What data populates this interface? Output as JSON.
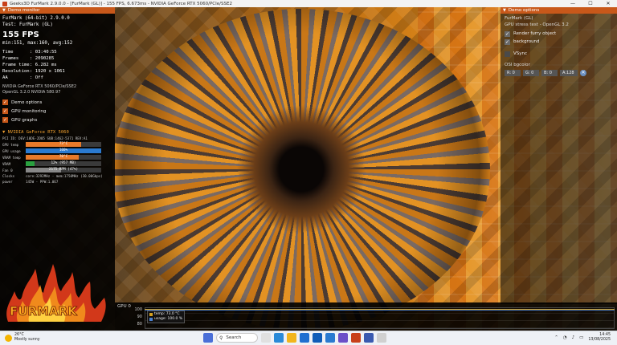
{
  "window": {
    "title": "Geeks3D FurMark 2.9.0.0 - [FurMark (GL)] - 155 FPS, 6.673ms - NVIDIA GeForce RTX 5060/PCIe/SSE2",
    "minimize": "—",
    "maximize": "☐",
    "close": "✕"
  },
  "demo_monitor": {
    "header": "Demo monitor",
    "app_line": "FurMark (64-bit) 2.9.0.0",
    "test_line": "Test: FurMark (GL)",
    "fps": "155 FPS",
    "fps_stats": "min:151, max:160, avg:152",
    "stats": [
      {
        "key": "Time",
        "value": ": 03:40:55"
      },
      {
        "key": "Frames",
        "value": ": 2090285"
      },
      {
        "key": "Frame time",
        "value": ": 6.282 ms"
      },
      {
        "key": "Resolution",
        "value": ": 1920 x 1061"
      },
      {
        "key": "AA",
        "value": ": Off"
      }
    ],
    "gpu_info": [
      "NVIDIA GeForce RTX 5060/PCIe/SSE2",
      "OpenGL 3.2.0 NVIDIA 580.97"
    ],
    "checkboxes": [
      {
        "label": "Demo options",
        "checked": true
      },
      {
        "label": "GPU monitoring",
        "checked": true
      },
      {
        "label": "GPU graphs",
        "checked": true
      }
    ],
    "gpu_monitor": {
      "header": "NVIDIA GeForce RTX 5060",
      "pci_line": "PCI ID:   DEV:10DE-2D05 SUB:1462-5371 REV:A1",
      "bars": [
        {
          "label": "GPU temp",
          "text": "73°C",
          "fraction": 0.73,
          "color": "#e87a2a"
        },
        {
          "label": "GPU usage",
          "text": "100%",
          "fraction": 1.0,
          "color": "#2a7ad0"
        },
        {
          "label": "VRAM temp",
          "text": "70°C",
          "fraction": 0.7,
          "color": "#e87a2a"
        },
        {
          "label": "VRAM",
          "text": "12% (957 MB)",
          "fraction": 0.12,
          "color": "#2aa040"
        },
        {
          "label": "Fan 0",
          "text": "2175 RPM (47%)",
          "fraction": 0.47,
          "color": "#888888"
        }
      ],
      "clocks_label": "Clocks",
      "clocks_value": "core:3292MHz - mem:1750MHz (30.00Gbps)",
      "power_label": "power",
      "power_value": "145W - PPW:1.067"
    },
    "logo_text": "FURMARK"
  },
  "demo_options": {
    "header": "Demo options",
    "line1": "FurMark (GL)",
    "line2": "GPU stress test - OpenGL 3.2",
    "checkboxes": [
      {
        "label": "Render furry object",
        "checked": true
      },
      {
        "label": "background",
        "checked": true
      },
      {
        "label": "VSync",
        "checked": false
      }
    ],
    "osi_label": "OSI bgcolor",
    "osi_fields": [
      "R: 0",
      "G: 0",
      "B: 0",
      "A:128"
    ],
    "reset": "✕"
  },
  "gpu_graph": {
    "label": "GPU 0",
    "ticks": [
      "100",
      "90",
      "80"
    ],
    "legend": [
      {
        "text": "temp: 73.0 °C",
        "color": "#d4a020"
      },
      {
        "text": "usage: 100.0 %",
        "color": "#4a80d0"
      }
    ]
  },
  "taskbar": {
    "weather_temp": "26°C",
    "weather_desc": "Mostly sunny",
    "search_placeholder": "Search",
    "time": "14:45",
    "date": "13/08/2025",
    "app_colors": [
      "#4a6fd8",
      "#e0e0e0",
      "#2a8ad8",
      "#f2b51c",
      "#1f6fd0",
      "#0f5cb8",
      "#2a7ad0",
      "#6b4fc8",
      "#c8401a",
      "#3a5ab0",
      "#d0d0d0"
    ]
  }
}
